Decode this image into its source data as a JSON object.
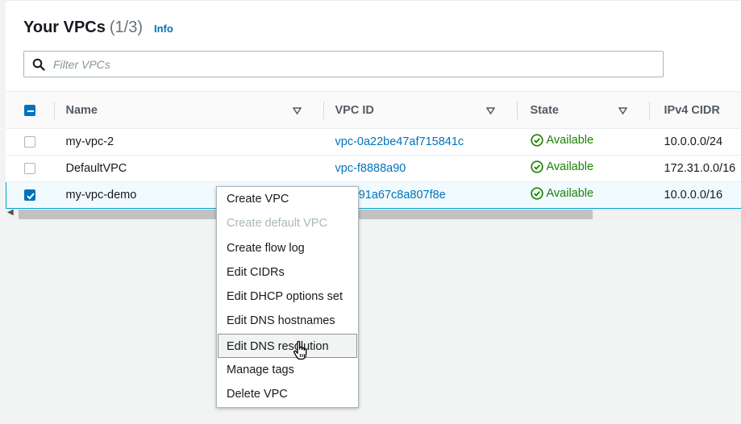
{
  "header": {
    "title": "Your VPCs",
    "count": "(1/3)",
    "info": "Info"
  },
  "filter": {
    "placeholder": "Filter VPCs",
    "value": ""
  },
  "table": {
    "columns": [
      "Name",
      "VPC ID",
      "State",
      "IPv4 CIDR"
    ],
    "rows": [
      {
        "name": "my-vpc-2",
        "vpc_id": "vpc-0a22be47af715841c",
        "state": "Available",
        "cidr": "10.0.0.0/24",
        "selected": false
      },
      {
        "name": "DefaultVPC",
        "vpc_id": "vpc-f8888a90",
        "state": "Available",
        "cidr": "172.31.0.0/16",
        "selected": false
      },
      {
        "name": "my-vpc-demo",
        "vpc_id": "04291a67c8a807f8e",
        "state": "Available",
        "cidr": "10.0.0.0/16",
        "selected": true
      }
    ]
  },
  "context_menu": {
    "items": [
      {
        "label": "Create VPC",
        "disabled": false
      },
      {
        "label": "Create default VPC",
        "disabled": true
      },
      {
        "label": "Create flow log",
        "disabled": false
      },
      {
        "label": "Edit CIDRs",
        "disabled": false
      },
      {
        "label": "Edit DHCP options set",
        "disabled": false
      },
      {
        "label": "Edit DNS hostnames",
        "disabled": false
      },
      {
        "label": "Edit DNS resolution",
        "disabled": false,
        "hovered": true
      },
      {
        "label": "Manage tags",
        "disabled": false
      },
      {
        "label": "Delete VPC",
        "disabled": false
      }
    ]
  },
  "colors": {
    "link": "#0073bb",
    "available": "#1d8102",
    "selected_row": "#f1faff",
    "selected_border": "#00a1c9"
  },
  "icons": {
    "search": "search-icon",
    "state": "check-circle-icon",
    "sort": "caret-down-icon",
    "cursor": "hand-pointer-icon"
  }
}
